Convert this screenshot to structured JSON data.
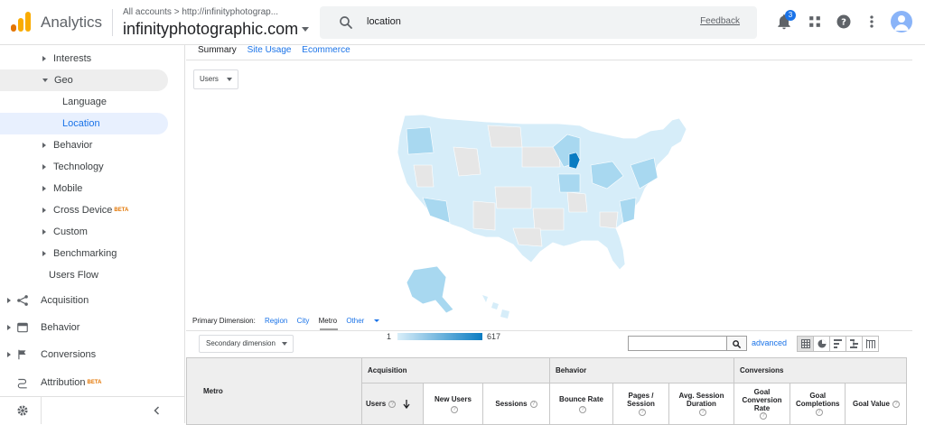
{
  "header": {
    "brand": "Analytics",
    "account_path": "All accounts > http://infinityphotograp...",
    "account_name": "infinityphotographic.com",
    "search_value": "location",
    "feedback_label": "Feedback",
    "notification_count": "3",
    "accent_color": "#1a73e8"
  },
  "sidebar": {
    "items": [
      {
        "label": "Interests"
      },
      {
        "label": "Geo"
      },
      {
        "label": "Language"
      },
      {
        "label": "Location"
      },
      {
        "label": "Behavior"
      },
      {
        "label": "Technology"
      },
      {
        "label": "Mobile"
      },
      {
        "label": "Cross Device",
        "badge": "BETA"
      },
      {
        "label": "Custom"
      },
      {
        "label": "Benchmarking"
      },
      {
        "label": "Users Flow"
      }
    ],
    "sections": [
      {
        "label": "Acquisition",
        "icon": "acquisition-icon"
      },
      {
        "label": "Behavior",
        "icon": "behavior-icon"
      },
      {
        "label": "Conversions",
        "icon": "flag-icon"
      },
      {
        "label": "Attribution",
        "icon": "attribution-icon",
        "badge": "BETA"
      }
    ],
    "active_item": "Location"
  },
  "report": {
    "tabs": [
      {
        "label": "Summary",
        "active": true
      },
      {
        "label": "Site Usage",
        "active": false
      },
      {
        "label": "Ecommerce",
        "active": false
      }
    ],
    "metric_selector": "Users",
    "map": {
      "legend_min": "1",
      "legend_max": "617",
      "color_low": "#d8eef9",
      "color_high": "#0a7cc2"
    },
    "primary_dimension": {
      "label": "Primary Dimension:",
      "options": [
        "Region",
        "City",
        "Metro",
        "Other"
      ],
      "selected": "Metro"
    },
    "secondary_dimension": "Secondary dimension",
    "advanced_label": "advanced",
    "table": {
      "first_col": "Metro",
      "groups": [
        "Acquisition",
        "Behavior",
        "Conversions"
      ],
      "columns": {
        "users": "Users",
        "new_users": "New Users",
        "sessions": "Sessions",
        "bounce_rate": "Bounce Rate",
        "pages_session": "Pages / Session",
        "avg_duration": "Avg. Session Duration",
        "goal_conv_rate": "Goal Conversion Rate",
        "goal_completions": "Goal Completions",
        "goal_value": "Goal Value"
      }
    }
  }
}
